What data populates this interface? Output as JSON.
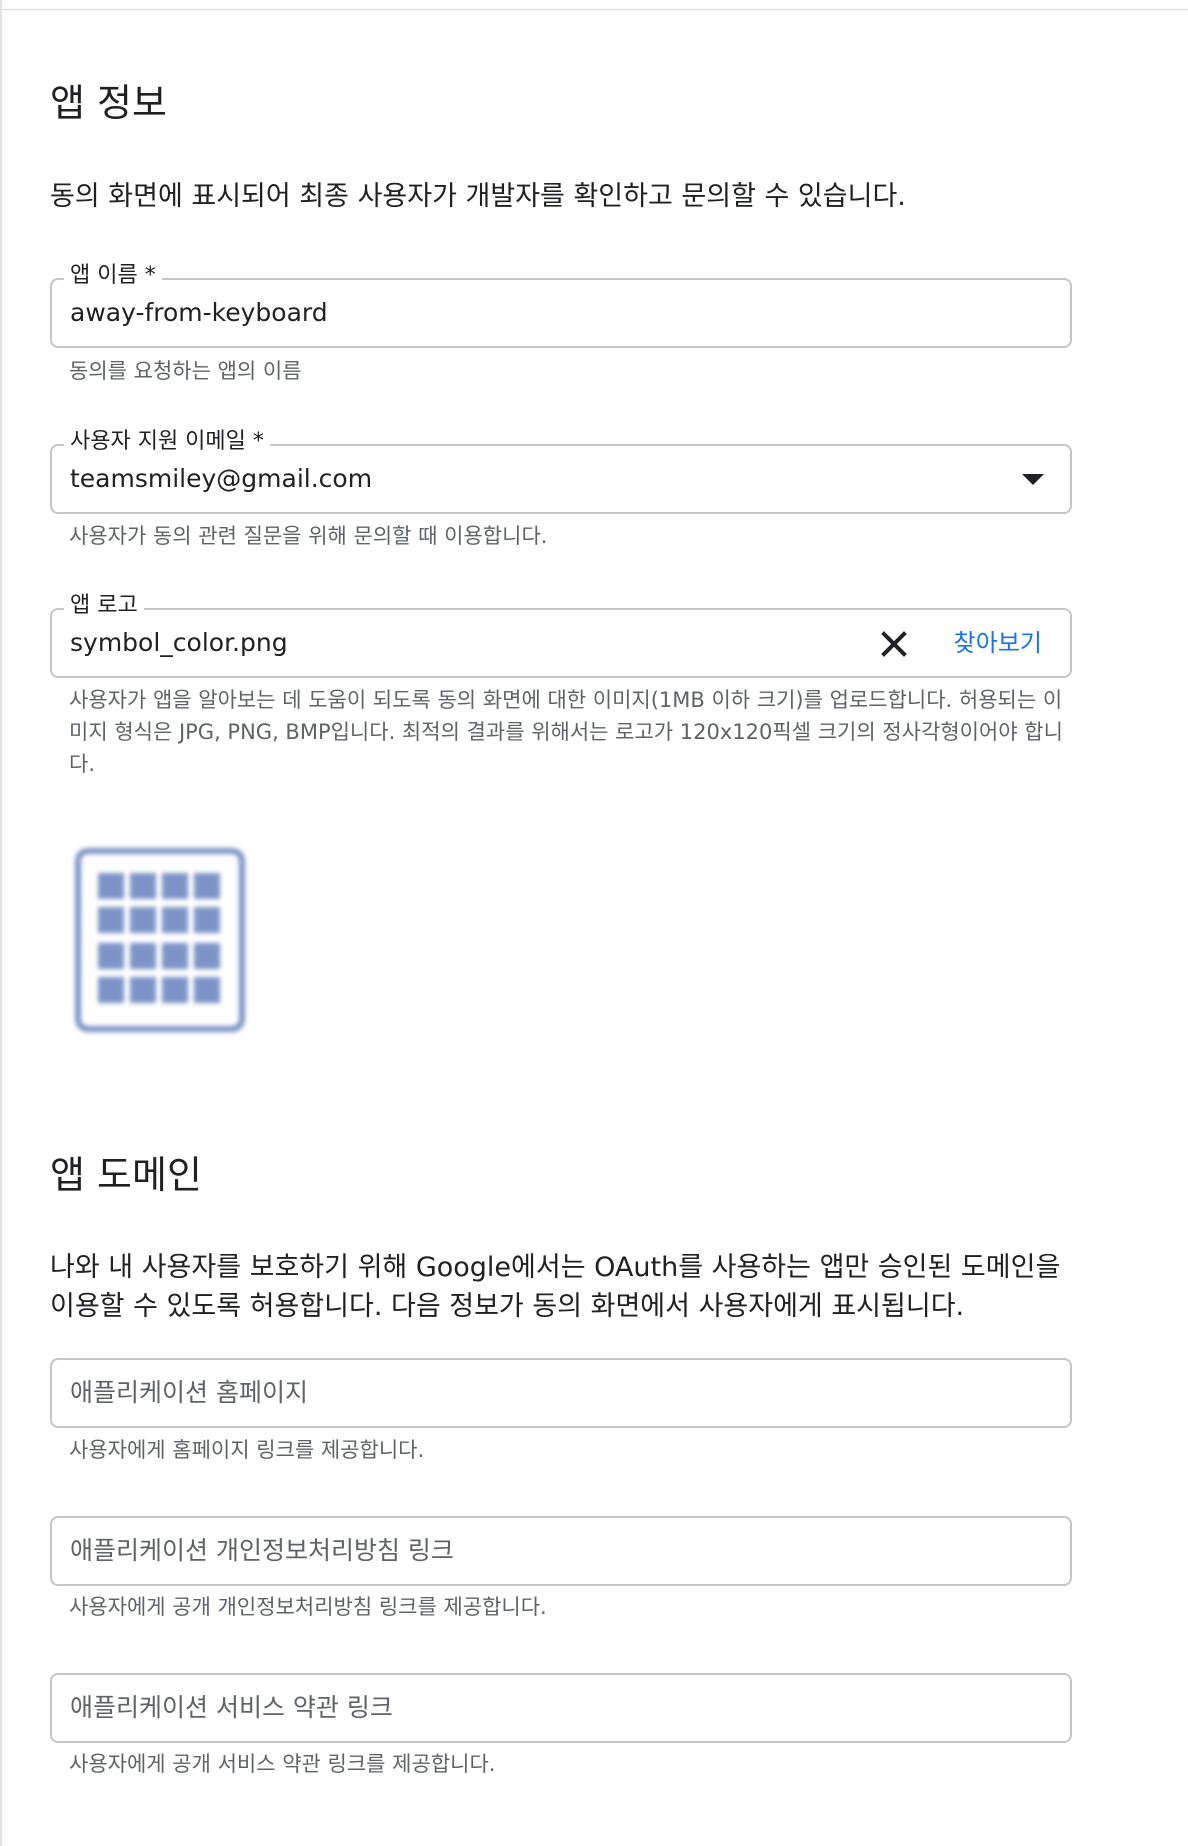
{
  "app_info": {
    "title": "앱 정보",
    "description": "동의 화면에 표시되어 최종 사용자가 개발자를 확인하고 문의할 수 있습니다.",
    "app_name": {
      "label": "앱 이름 *",
      "value": "away-from-keyboard",
      "hint": "동의를 요청하는 앱의 이름"
    },
    "support_email": {
      "label": "사용자 지원 이메일 *",
      "value": "teamsmiley@gmail.com",
      "hint": "사용자가 동의 관련 질문을 위해 문의할 때 이용합니다.",
      "icon": "dropdown-arrow-icon"
    },
    "app_logo": {
      "label": "앱 로고",
      "value": "symbol_color.png",
      "clear_icon": "close-icon",
      "browse_label": "찾아보기",
      "hint": "사용자가 앱을 알아보는 데 도움이 되도록 동의 화면에 대한 이미지(1MB 이하 크기)를 업로드합니다. 허용되는 이미지 형식은 JPG, PNG, BMP입니다. 최적의 결과를 위해서는 로고가 120x120픽셀 크기의 정사각형이어야 합니다."
    }
  },
  "app_domain": {
    "title": "앱 도메인",
    "description": "나와 내 사용자를 보호하기 위해 Google에서는 OAuth를 사용하는 앱만 승인된 도메인을 이용할 수 있도록 허용합니다. 다음 정보가 동의 화면에서 사용자에게 표시됩니다.",
    "homepage": {
      "placeholder": "애플리케이션 홈페이지",
      "hint": "사용자에게 홈페이지 링크를 제공합니다."
    },
    "privacy_policy": {
      "placeholder": "애플리케이션 개인정보처리방침 링크",
      "hint": "사용자에게 공개 개인정보처리방침 링크를 제공합니다."
    },
    "terms_of_service": {
      "placeholder": "애플리케이션 서비스 약관 링크",
      "hint": "사용자에게 공개 서비스 약관 링크를 제공합니다."
    }
  },
  "colors": {
    "accent": "#1a73e8",
    "logo_tile": "#7b93c6",
    "border": "#c6c6c6"
  }
}
